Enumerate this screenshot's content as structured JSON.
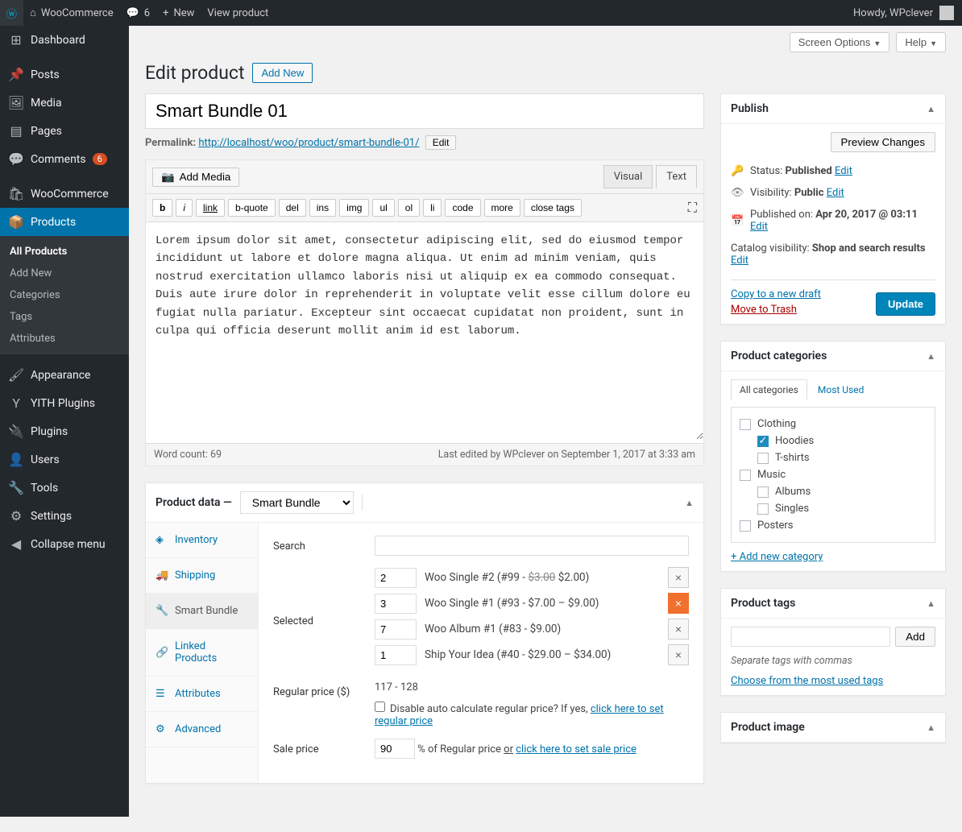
{
  "topbar": {
    "site": "WooCommerce",
    "comments": "6",
    "new": "New",
    "view": "View product",
    "howdy": "Howdy, WPclever"
  },
  "sidebar": {
    "dashboard": "Dashboard",
    "posts": "Posts",
    "media": "Media",
    "pages": "Pages",
    "comments": "Comments",
    "comments_badge": "6",
    "woocommerce": "WooCommerce",
    "products": "Products",
    "sub": {
      "all": "All Products",
      "addnew": "Add New",
      "categories": "Categories",
      "tags": "Tags",
      "attributes": "Attributes"
    },
    "appearance": "Appearance",
    "yith": "YITH Plugins",
    "plugins": "Plugins",
    "users": "Users",
    "tools": "Tools",
    "settings": "Settings",
    "collapse": "Collapse menu"
  },
  "header": {
    "screen_options": "Screen Options",
    "help": "Help",
    "page_title": "Edit product",
    "add_new": "Add New"
  },
  "title": "Smart Bundle 01",
  "permalink": {
    "label": "Permalink:",
    "base": "http://localhost/woo/product/",
    "slug": "smart-bundle-01",
    "slash": "/",
    "edit": "Edit"
  },
  "editor": {
    "add_media": "Add Media",
    "tabs": {
      "visual": "Visual",
      "text": "Text"
    },
    "qtags": [
      "b",
      "i",
      "link",
      "b-quote",
      "del",
      "ins",
      "img",
      "ul",
      "ol",
      "li",
      "code",
      "more",
      "close tags"
    ],
    "content": "Lorem ipsum dolor sit amet, consectetur adipiscing elit, sed do eiusmod tempor incididunt ut labore et dolore magna aliqua. Ut enim ad minim veniam, quis nostrud exercitation ullamco laboris nisi ut aliquip ex ea commodo consequat. Duis aute irure dolor in reprehenderit in voluptate velit esse cillum dolore eu fugiat nulla pariatur. Excepteur sint occaecat cupidatat non proident, sunt in culpa qui officia deserunt mollit anim id est laborum.",
    "word_count": "Word count: 69",
    "last_edit": "Last edited by WPclever on September 1, 2017 at 3:33 am"
  },
  "product_data": {
    "header_label": "Product data —",
    "type": "Smart Bundle",
    "tabs": {
      "inventory": "Inventory",
      "shipping": "Shipping",
      "smart_bundle": "Smart Bundle",
      "linked": "Linked Products",
      "attributes": "Attributes",
      "advanced": "Advanced"
    },
    "search_label": "Search",
    "selected_label": "Selected",
    "rows": [
      {
        "qty": "2",
        "name": "Woo Single #2 (#99 - ",
        "strike": "$3.00",
        "after": " $2.00)",
        "highlight": false
      },
      {
        "qty": "3",
        "name": "Woo Single #1 (#93 - $7.00 – $9.00)",
        "strike": "",
        "after": "",
        "highlight": true
      },
      {
        "qty": "7",
        "name": "Woo Album #1 (#83 - $9.00)",
        "strike": "",
        "after": "",
        "highlight": false
      },
      {
        "qty": "1",
        "name": "Ship Your Idea (#40 - $29.00 – $34.00)",
        "strike": "",
        "after": "",
        "highlight": false
      }
    ],
    "regular_price_label": "Regular price ($)",
    "regular_price_value": "117 - 128",
    "disable_auto_text": "Disable auto calculate regular price? If yes, ",
    "disable_auto_link": "click here to set regular price",
    "sale_price_label": "Sale price",
    "sale_pct": "90",
    "sale_pct_after": "% of Regular price ",
    "or": "or",
    "sale_link": " click here to set sale price"
  },
  "publish": {
    "title": "Publish",
    "preview": "Preview Changes",
    "status_label": "Status: ",
    "status_value": "Published",
    "vis_label": "Visibility: ",
    "vis_value": "Public",
    "pub_label": "Published on: ",
    "pub_value": "Apr 20, 2017 @ 03:11",
    "catalog_label": "Catalog visibility: ",
    "catalog_value": "Shop and search results",
    "edit": "Edit",
    "copy": "Copy to a new draft",
    "trash": "Move to Trash",
    "update": "Update"
  },
  "categories": {
    "title": "Product categories",
    "tab_all": "All categories",
    "tab_most": "Most Used",
    "items": [
      {
        "label": "Clothing",
        "nested": false,
        "checked": false
      },
      {
        "label": "Hoodies",
        "nested": true,
        "checked": true
      },
      {
        "label": "T-shirts",
        "nested": true,
        "checked": false
      },
      {
        "label": "Music",
        "nested": false,
        "checked": false
      },
      {
        "label": "Albums",
        "nested": true,
        "checked": false
      },
      {
        "label": "Singles",
        "nested": true,
        "checked": false
      },
      {
        "label": "Posters",
        "nested": false,
        "checked": false
      }
    ],
    "add_new": "+ Add new category"
  },
  "tags": {
    "title": "Product tags",
    "add": "Add",
    "help": "Separate tags with commas",
    "choose": "Choose from the most used tags"
  },
  "image": {
    "title": "Product image"
  }
}
